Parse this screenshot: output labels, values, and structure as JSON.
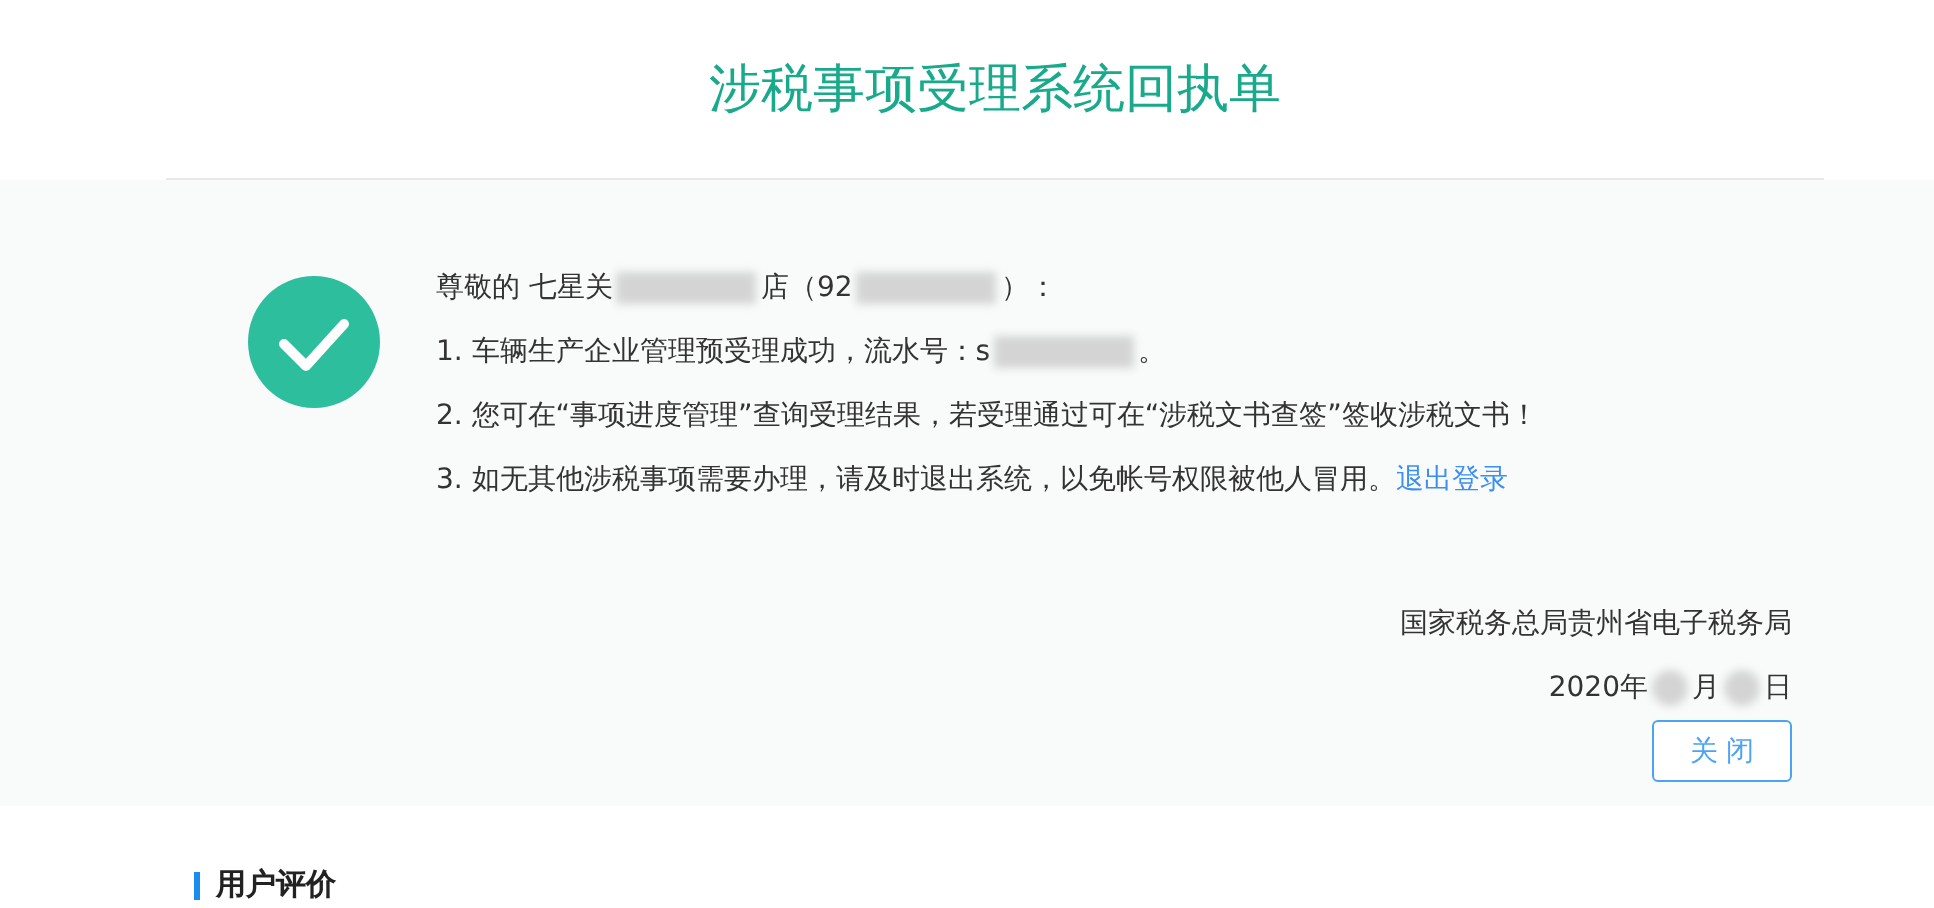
{
  "title": "涉税事项受理系统回执单",
  "greeting": [
    {
      "kind": "text",
      "text": "尊敬的 七星关"
    },
    {
      "kind": "redacted"
    },
    {
      "kind": "text",
      "text": "店（92"
    },
    {
      "kind": "redacted"
    },
    {
      "kind": "text",
      "text": "）："
    }
  ],
  "lines": [
    [
      {
        "kind": "text",
        "text": "1. 车辆生产企业管理预受理成功，流水号：s"
      },
      {
        "kind": "redacted"
      },
      {
        "kind": "text",
        "text": "。"
      }
    ],
    [
      {
        "kind": "text",
        "text": "2. 您可在“事项进度管理”查询受理结果，若受理通过可在“涉税文书查签”签收涉税文书！"
      }
    ],
    [
      {
        "kind": "text",
        "text": "3. 如无其他涉税事项需要办理，请及时退出系统，以免帐号权限被他人冒用。"
      },
      {
        "kind": "link",
        "text": "退出登录"
      }
    ]
  ],
  "issuer": "国家税务总局贵州省电子税务局",
  "date": [
    {
      "kind": "text",
      "text": "2020年"
    },
    {
      "kind": "redacted"
    },
    {
      "kind": "text",
      "text": "月"
    },
    {
      "kind": "redacted"
    },
    {
      "kind": "text",
      "text": "日"
    }
  ],
  "close_button": "关 闭",
  "section_title": "用户评价"
}
